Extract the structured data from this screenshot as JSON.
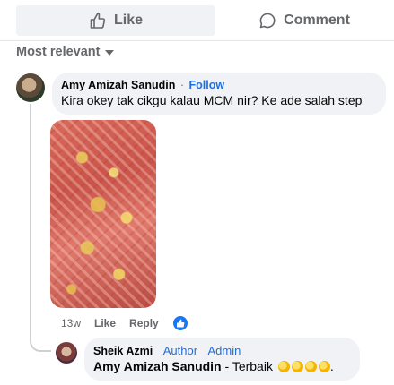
{
  "actions": {
    "like_label": "Like",
    "comment_label": "Comment"
  },
  "sort": {
    "label": "Most relevant"
  },
  "comment": {
    "author": "Amy Amizah Sanudin",
    "separator": "·",
    "follow_label": "Follow",
    "text": "Kira okey tak cikgu kalau MCM nir? Ke ade salah step",
    "time": "13w",
    "like_label": "Like",
    "reply_label": "Reply",
    "reaction_icon": "like-reaction-icon"
  },
  "reply": {
    "author": "Sheik Azmi",
    "badges": [
      "Author",
      "Admin"
    ],
    "mention": "Amy Amizah Sanudin",
    "text": " - Terbaik ",
    "emoji_icon": "clapping-hands-icon",
    "trailing": "."
  },
  "colors": {
    "link_blue": "#216fdb",
    "like_blue": "#1877f2",
    "muted_text": "#65676b",
    "bubble_bg": "#f0f2f5"
  }
}
